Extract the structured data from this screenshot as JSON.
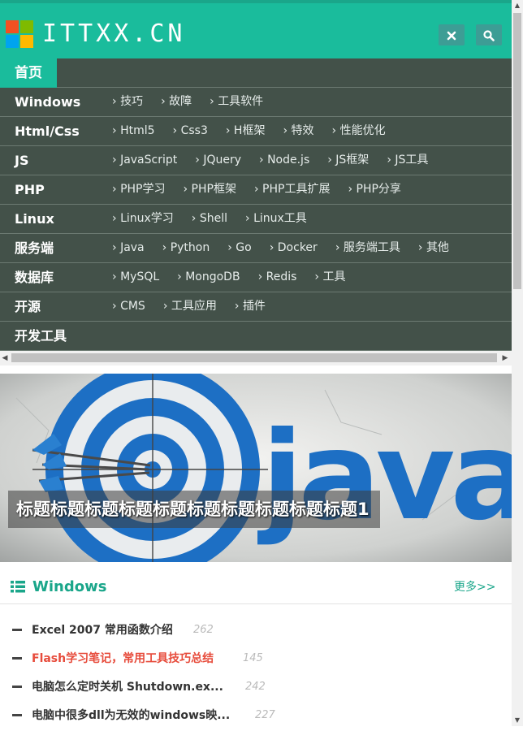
{
  "header": {
    "site_name": "ITTXX.CN",
    "close_icon": "close-icon",
    "search_icon": "search-icon",
    "colors": {
      "bar": "#1abc9c",
      "button": "#3d9d95"
    }
  },
  "nav": {
    "home_label": "首页",
    "rows": [
      {
        "label": "Windows",
        "subs": [
          "技巧",
          "故障",
          "工具软件"
        ]
      },
      {
        "label": "Html/Css",
        "subs": [
          "Html5",
          "Css3",
          "H框架",
          "特效",
          "性能优化"
        ]
      },
      {
        "label": "JS",
        "subs": [
          "JavaScript",
          "JQuery",
          "Node.js",
          "JS框架",
          "JS工具"
        ]
      },
      {
        "label": "PHP",
        "subs": [
          "PHP学习",
          "PHP框架",
          "PHP工具扩展",
          "PHP分享"
        ]
      },
      {
        "label": "Linux",
        "subs": [
          "Linux学习",
          "Shell",
          "Linux工具"
        ]
      },
      {
        "label": "服务端",
        "subs": [
          "Java",
          "Python",
          "Go",
          "Docker",
          "服务端工具",
          "其他"
        ]
      },
      {
        "label": "数据库",
        "subs": [
          "MySQL",
          "MongoDB",
          "Redis",
          "工具"
        ]
      },
      {
        "label": "开源",
        "subs": [
          "CMS",
          "工具应用",
          "插件"
        ]
      },
      {
        "label": "开发工具",
        "subs": []
      }
    ]
  },
  "banner": {
    "caption": "标题标题标题标题标题标题标题标题标题标题1",
    "image_text": "java"
  },
  "section": {
    "icon": "list-icon",
    "title": "Windows",
    "more": "更多>>",
    "items": [
      {
        "title": "Excel 2007 常用函数介绍",
        "count": "262"
      },
      {
        "title": "Flash学习笔记，常用工具技巧总结",
        "count": "145",
        "active": true
      },
      {
        "title": "电脑怎么定时关机 Shutdown.ex...",
        "count": "242"
      },
      {
        "title": "电脑中很多dll为无效的windows映...",
        "count": "227"
      }
    ]
  }
}
